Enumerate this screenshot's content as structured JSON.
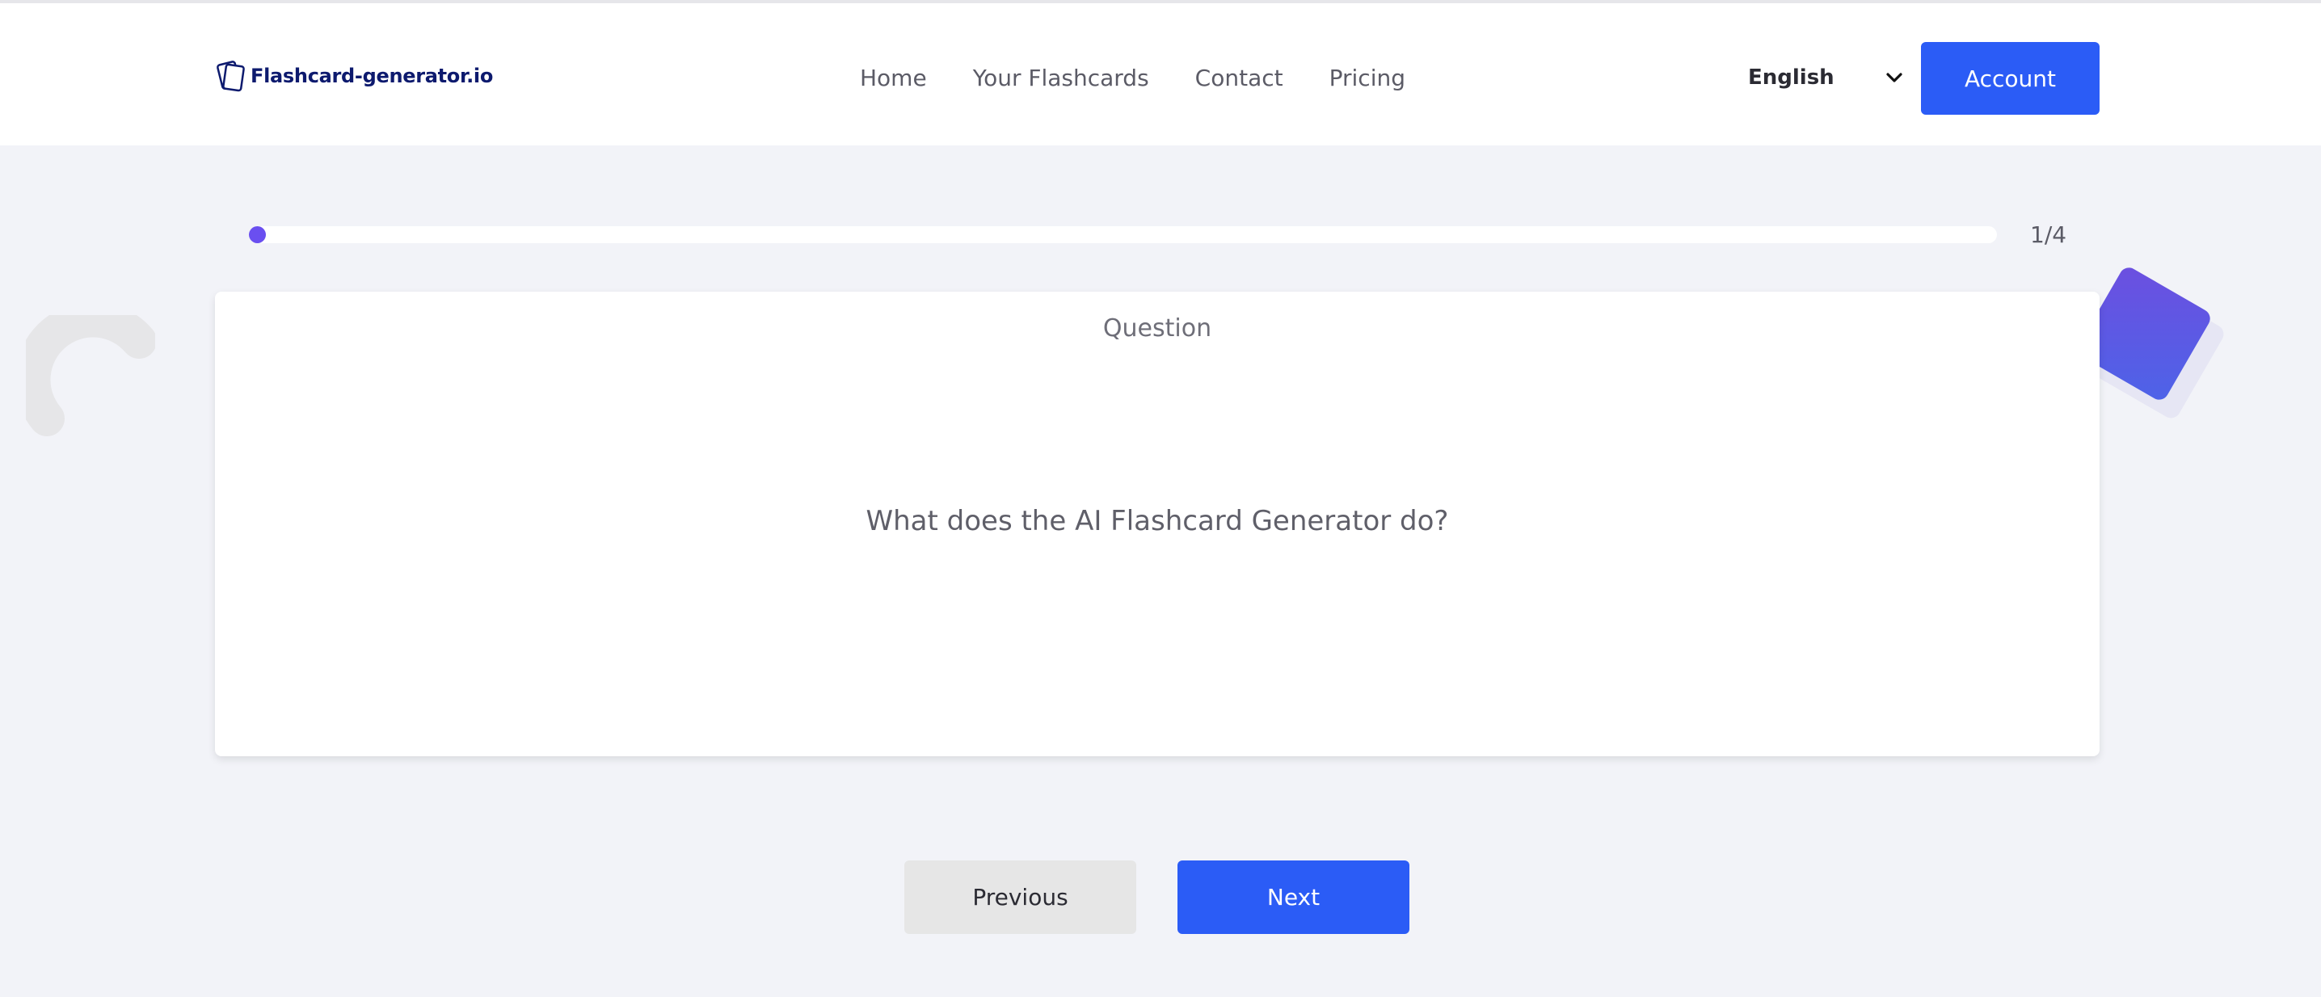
{
  "header": {
    "logo_text": "Flashcard-generator.io",
    "nav": [
      "Home",
      "Your Flashcards",
      "Contact",
      "Pricing"
    ],
    "language": "English",
    "account_label": "Account"
  },
  "progress": {
    "current": 1,
    "total": 4,
    "label": "1/4",
    "fill_fraction": 0
  },
  "card": {
    "label": "Question",
    "text": "What does the AI Flashcard Generator do?"
  },
  "controls": {
    "previous_label": "Previous",
    "next_label": "Next"
  },
  "colors": {
    "accent": "#2b5cf6",
    "progress": "#6a4ff0",
    "background": "#f2f3f8",
    "logo": "#0d1a6e"
  }
}
